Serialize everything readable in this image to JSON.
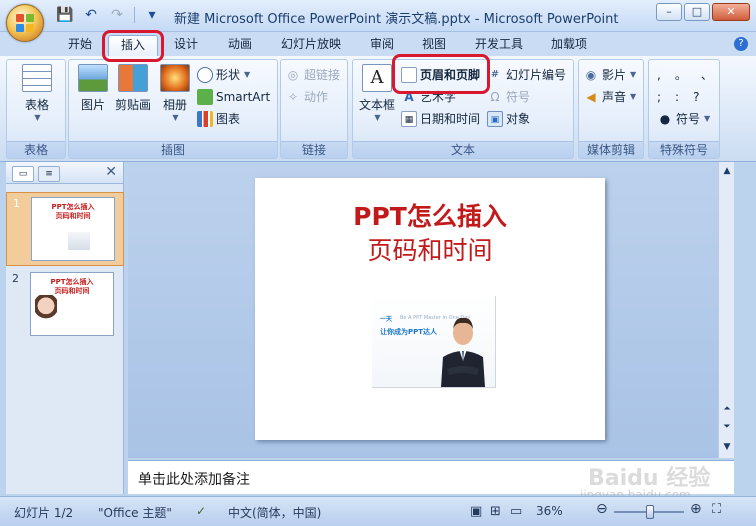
{
  "window": {
    "title": "新建 Microsoft Office PowerPoint 演示文稿.pptx - Microsoft PowerPoint",
    "minimize": "–",
    "maximize": "□",
    "close": "✕"
  },
  "quick_access": {
    "save": "💾",
    "undo": "↶",
    "redo": "↷",
    "more": "▾"
  },
  "tabs": [
    "开始",
    "插入",
    "设计",
    "动画",
    "幻灯片放映",
    "审阅",
    "视图",
    "开发工具",
    "加载项"
  ],
  "active_tab": "插入",
  "help": "?",
  "ribbon": {
    "table_group": {
      "label": "表格",
      "table": "表格"
    },
    "image_group": {
      "label": "插图",
      "picture": "图片",
      "clipart": "剪贴画",
      "album": "相册",
      "shapes": "形状",
      "smartart": "SmartArt",
      "chart": "图表"
    },
    "link_group": {
      "label": "链接",
      "hyperlink": "超链接",
      "action": "动作"
    },
    "text_group": {
      "label": "文本",
      "textbox": "文本框",
      "header_footer": "页眉和页脚",
      "wordart": "艺术字",
      "datetime": "日期和时间",
      "slide_number": "幻灯片编号",
      "symbol": "符号",
      "object": "对象"
    },
    "media_group": {
      "label": "媒体剪辑",
      "movie": "影片",
      "sound": "声音"
    },
    "special_group": {
      "label": "特殊符号",
      "symbols": "符号",
      "glyphs": [
        ",",
        "。",
        "、",
        ";",
        ":",
        "?"
      ]
    }
  },
  "slides": [
    {
      "number": "1",
      "title": "PPT怎么插入\n页码和时间"
    },
    {
      "number": "2",
      "title": "PPT怎么插入\n页码和时间"
    }
  ],
  "main_slide": {
    "title_line1": "PPT怎么插入",
    "title_line2": "页码和时间",
    "img_tag1": "一天",
    "img_tag2": "让你成为PPT达人",
    "img_tag3": "Be A PPT Master in One Day"
  },
  "notes_placeholder": "单击此处添加备注",
  "status": {
    "slide_info": "幻灯片 1/2",
    "theme": "\"Office 主题\"",
    "language": "中文(简体，中国)",
    "zoom": "36%"
  },
  "watermark": {
    "brand": "Baidu 经验",
    "url": "jingyan.baidu.com"
  },
  "colors": {
    "title_red": "#c21a1a",
    "highlight_red": "#d7182e",
    "ribbon_blue": "#dbe8f8"
  }
}
